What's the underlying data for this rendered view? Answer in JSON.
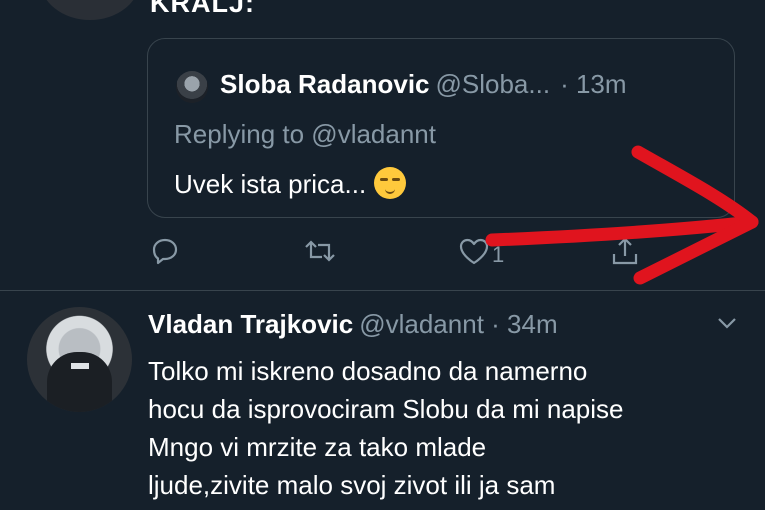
{
  "prev_tweet": {
    "text_fragment": "KRALJ:"
  },
  "quoted_tweet": {
    "name": "Sloba Radanovic",
    "handle": "@Sloba...",
    "time": "· 13m",
    "replying_to": "Replying to @vladannt",
    "text": "Uvek ista prica...",
    "emoji": "smirking-face-emoji"
  },
  "actions": {
    "reply_icon": "reply-icon",
    "retweet_icon": "retweet-icon",
    "like_icon": "heart-icon",
    "like_count": "1",
    "share_icon": "share-icon"
  },
  "tweet2": {
    "name": "Vladan Trajkovic",
    "handle": "@vladannt · 34m",
    "lines": [
      "Tolko mi iskreno dosadno da namerno",
      "hocu da isprovociram Slobu da mi napise",
      "Mngo vi mrzite za tako mlade",
      "ljude,zivite malo svoj zivot ili ja sam"
    ]
  },
  "colors": {
    "background": "#15202b",
    "secondary_text": "#8899a6",
    "border": "#38444d",
    "annotation_arrow": "#e0141e"
  }
}
